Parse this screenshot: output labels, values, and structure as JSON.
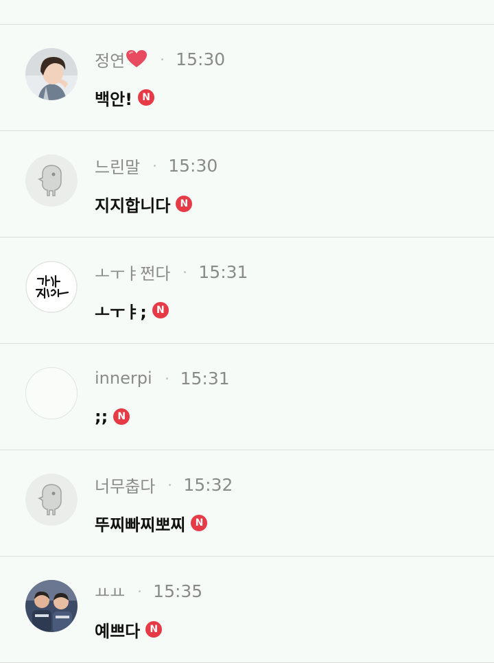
{
  "comments": [
    {
      "author": "정연",
      "time": "15:30",
      "text": "백안!",
      "badge": "N",
      "avatar": "photo-woman-icon",
      "author_decoration": "heart-icon"
    },
    {
      "author": "느린말",
      "time": "15:30",
      "text": "지지합니다",
      "badge": "N",
      "avatar": "default-character-icon"
    },
    {
      "author": "ㅗㅜㅑ쩐다",
      "time": "15:31",
      "text": "ㅗㅜㅑ;",
      "badge": "N",
      "avatar": "calligraphy-icon"
    },
    {
      "author": "innerpi",
      "time": "15:31",
      "text": ";;",
      "badge": "N",
      "avatar": "empty"
    },
    {
      "author": "너무춥다",
      "time": "15:32",
      "text": "뚜찌빠찌뽀찌",
      "badge": "N",
      "avatar": "default-character-icon"
    },
    {
      "author": "ㅛㅛ",
      "time": "15:35",
      "text": "예쁘다",
      "badge": "N",
      "avatar": "photo-kids-icon"
    }
  ],
  "colors": {
    "background": "#f7fbf7",
    "divider": "#dcdfdc",
    "meta_text": "#8a8a8a",
    "body_text": "#111111",
    "badge": "#e63a46",
    "heart": "#e84a5f"
  }
}
